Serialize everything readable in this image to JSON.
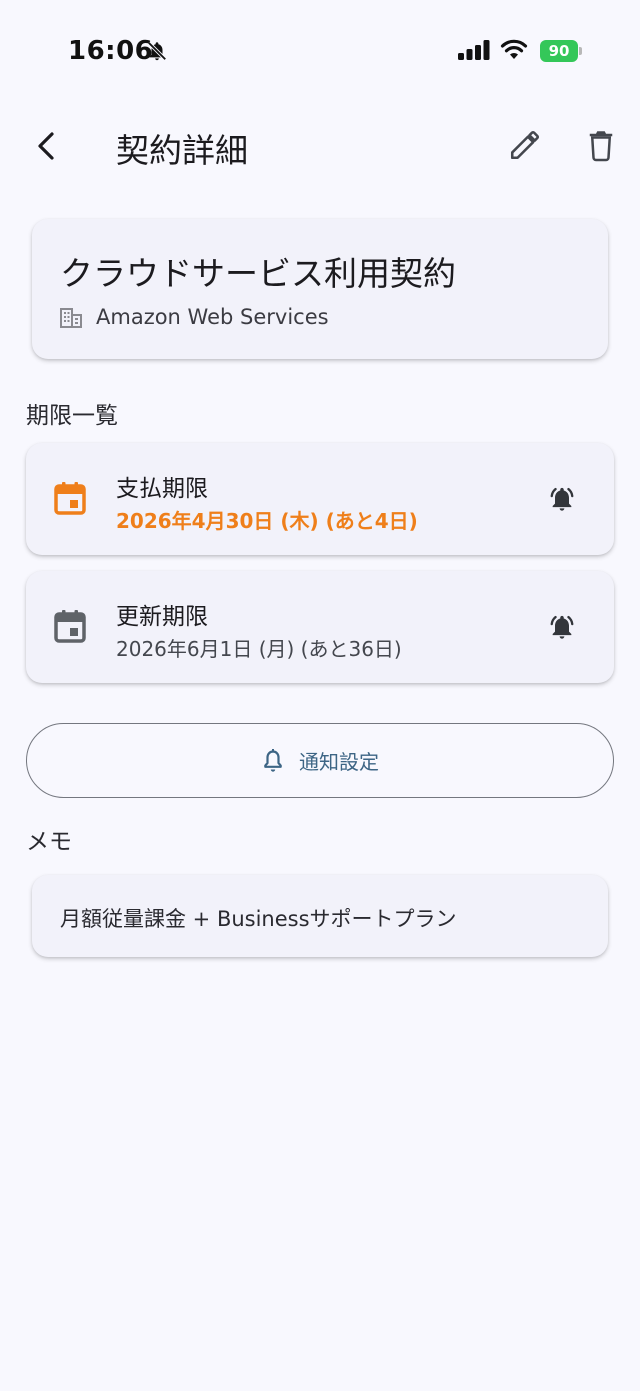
{
  "status_bar": {
    "time": "16:06",
    "battery": "90"
  },
  "app_bar": {
    "title": "契約詳細"
  },
  "contract": {
    "title": "クラウドサービス利用契約",
    "vendor": "Amazon Web Services"
  },
  "deadlines": {
    "section_label": "期限一覧",
    "items": [
      {
        "name": "支払期限",
        "date": "2026年4月30日 (木) (あと4日)"
      },
      {
        "name": "更新期限",
        "date": "2026年6月1日 (月) (あと36日)"
      }
    ]
  },
  "notification_button": {
    "label": "通知設定"
  },
  "memo": {
    "section_label": "メモ",
    "text": "月額従量課金 + Businessサポートプラン"
  },
  "colors": {
    "urgent": "#ef7f1a",
    "normal_icon": "#5f6368",
    "button_text": "#3d6585",
    "battery": "#34c759"
  }
}
